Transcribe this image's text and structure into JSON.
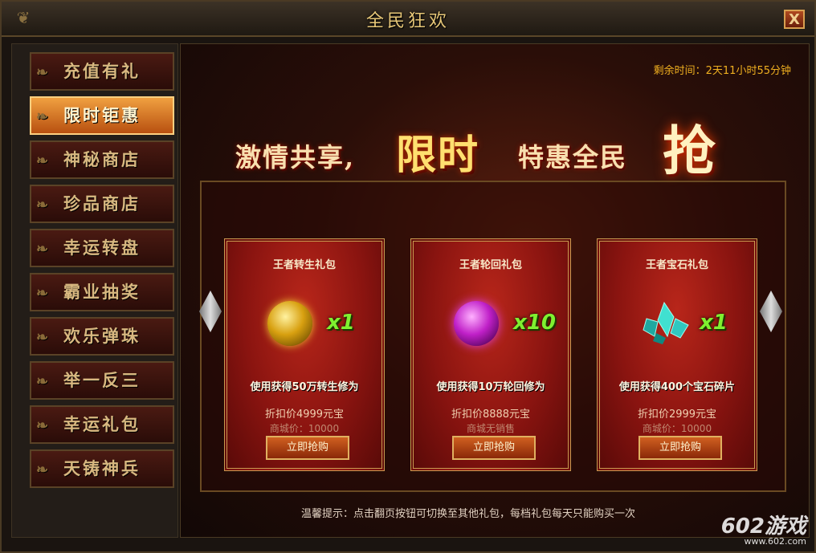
{
  "window": {
    "title": "全民狂欢",
    "close_label": "X"
  },
  "sidebar": {
    "items": [
      {
        "label": "充值有礼"
      },
      {
        "label": "限时钜惠"
      },
      {
        "label": "神秘商店"
      },
      {
        "label": "珍品商店"
      },
      {
        "label": "幸运转盘"
      },
      {
        "label": "霸业抽奖"
      },
      {
        "label": "欢乐弹珠"
      },
      {
        "label": "举一反三"
      },
      {
        "label": "幸运礼包"
      },
      {
        "label": "天铸神兵"
      }
    ],
    "active_index": 1
  },
  "main": {
    "timer": "剩余时间：2天11小时55分钟",
    "banner": {
      "part1": "激情共享,",
      "part2": "限时",
      "part3": "特惠全民",
      "part4": "抢"
    },
    "cards": [
      {
        "title": "王者转生礼包",
        "icon": "gold-orb-icon",
        "qty": "x1",
        "desc": "使用获得50万转生修为",
        "price": "折扣价4999元宝",
        "orig": "商城价：10000",
        "buy_label": "立即抢购"
      },
      {
        "title": "王者轮回礼包",
        "icon": "purple-orb-icon",
        "qty": "x10",
        "desc": "使用获得10万轮回修为",
        "price": "折扣价8888元宝",
        "orig": "商城无销售",
        "buy_label": "立即抢购"
      },
      {
        "title": "王者宝石礼包",
        "icon": "crystal-shards-icon",
        "qty": "x1",
        "desc": "使用获得400个宝石碎片",
        "price": "折扣价2999元宝",
        "orig": "商城价：10000",
        "buy_label": "立即抢购"
      }
    ],
    "hint": "温馨提示：点击翻页按钮可切换至其他礼包，每档礼包每天只能购买一次"
  },
  "watermark": {
    "brand": "602游戏",
    "url": "www.602.com"
  },
  "colors": {
    "accent": "#f0b020",
    "qty_green": "#7ff030",
    "card_red": "#8a1410"
  }
}
